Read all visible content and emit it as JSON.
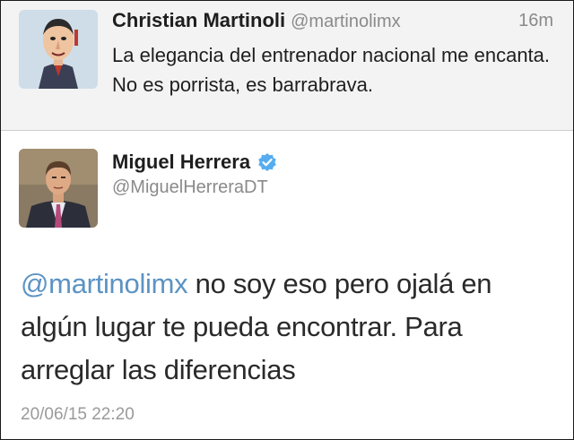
{
  "reply_context": {
    "name": "Christian Martinoli",
    "handle": "@martinolimx",
    "time": "16m",
    "text": "La elegancia del entrenador nacional me encanta. No es porrista, es barrabrava."
  },
  "main_tweet": {
    "name": "Miguel Herrera",
    "handle": "@MiguelHerreraDT",
    "mention": "@martinolimx",
    "text": " no soy eso pero ojalá en algún lugar te pueda encontrar. Para arreglar las diferencias",
    "date": "20/06/15 22:20"
  },
  "colors": {
    "mention": "#5c93c4",
    "verified": "#55acee",
    "context_bg": "#f3f3f3"
  },
  "icons": {
    "verified": "verified-badge-icon"
  }
}
